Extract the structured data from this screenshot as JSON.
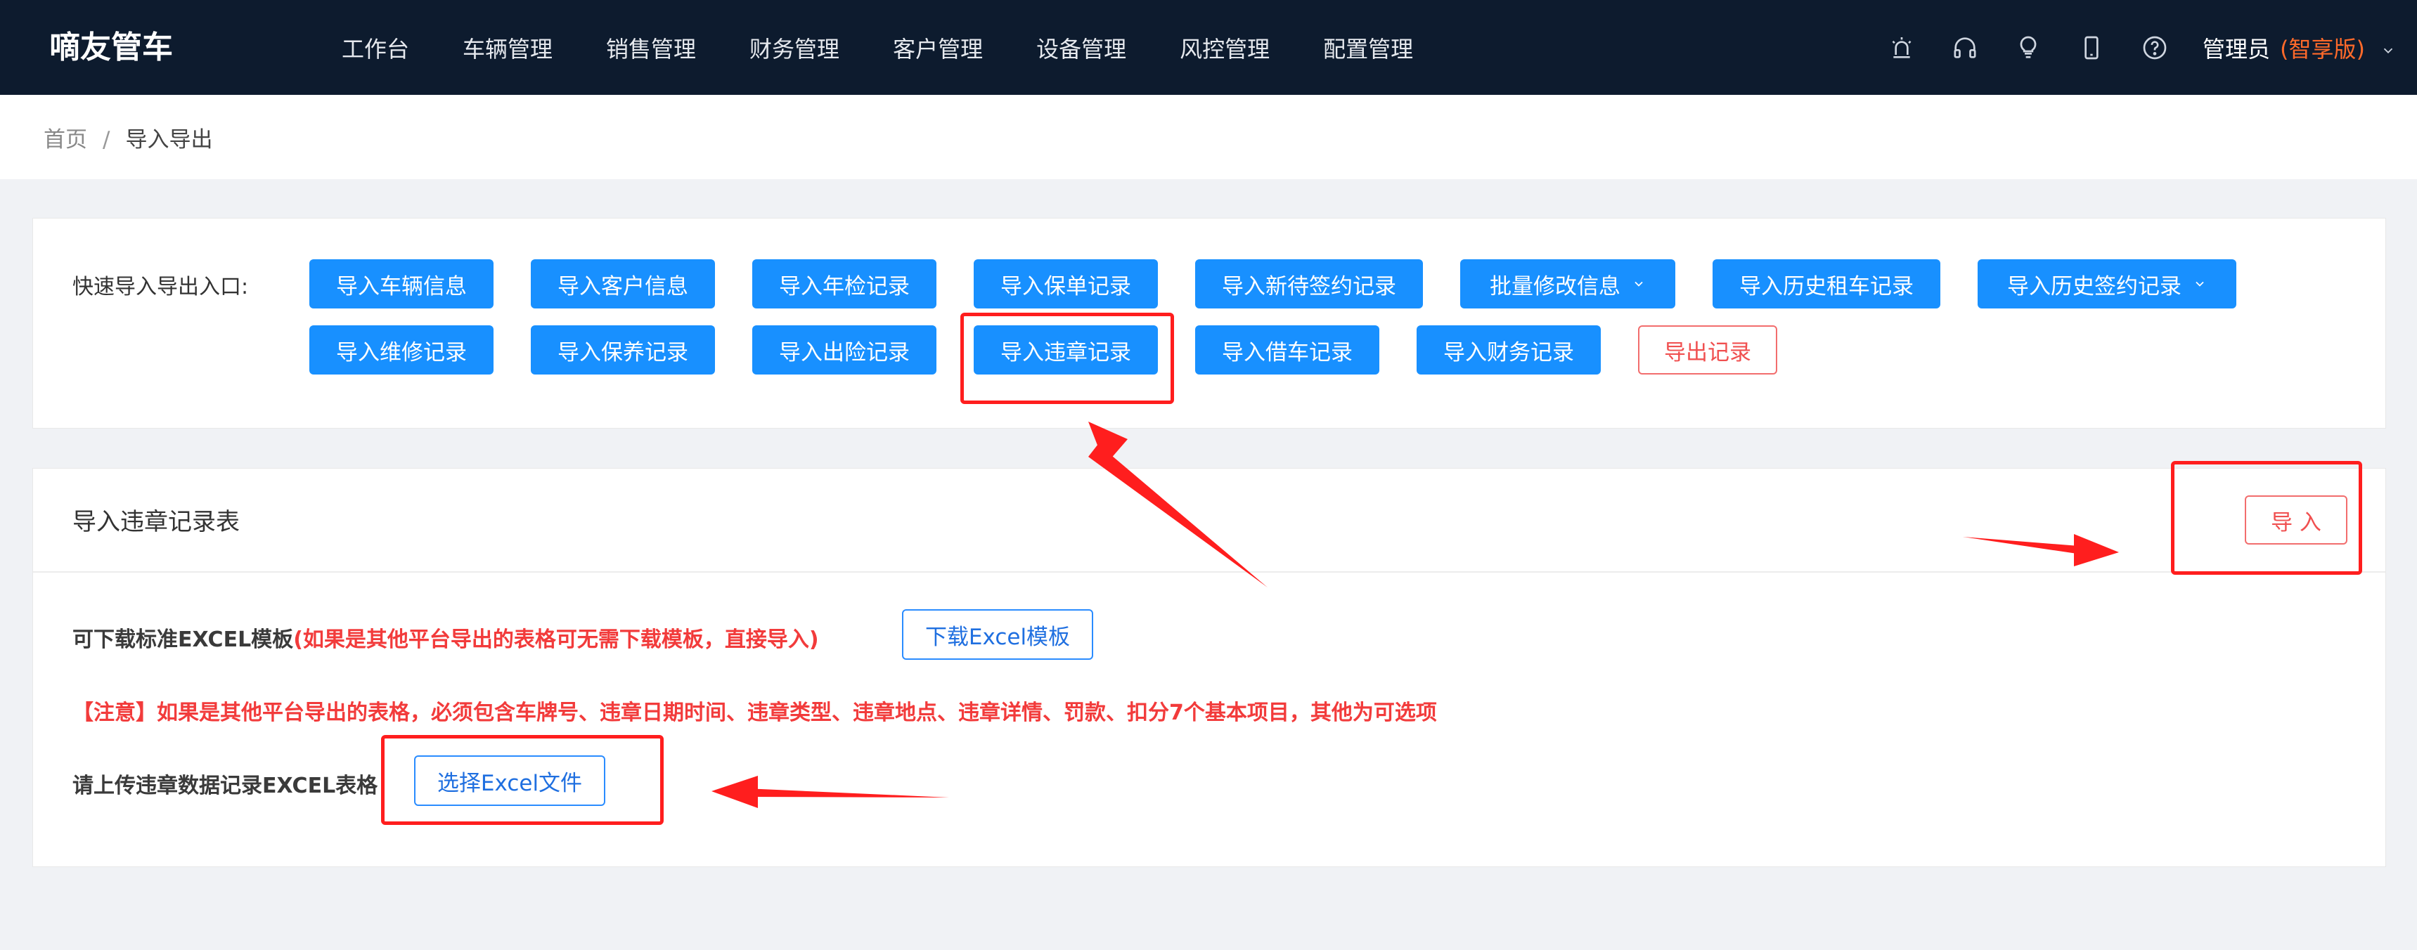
{
  "app": {
    "title": "嘀友管车"
  },
  "nav": {
    "items": [
      "工作台",
      "车辆管理",
      "销售管理",
      "财务管理",
      "客户管理",
      "设备管理",
      "风控管理",
      "配置管理"
    ]
  },
  "header": {
    "icons": [
      "alarm-icon",
      "headset-icon",
      "bulb-icon",
      "mobile-icon",
      "help-icon"
    ],
    "user_name": "管理员",
    "edition": "(智享版)"
  },
  "breadcrumb": {
    "home": "首页",
    "separator": "/",
    "current": "导入导出"
  },
  "quick": {
    "label": "快速导入导出入口:",
    "row1": [
      {
        "label": "导入车辆信息"
      },
      {
        "label": "导入客户信息"
      },
      {
        "label": "导入年检记录"
      },
      {
        "label": "导入保单记录"
      },
      {
        "label": "导入新待签约记录"
      },
      {
        "label": "批量修改信息",
        "dropdown": true
      },
      {
        "label": "导入历史租车记录"
      },
      {
        "label": "导入历史签约记录",
        "dropdown": true
      }
    ],
    "row2": [
      {
        "label": "导入维修记录"
      },
      {
        "label": "导入保养记录"
      },
      {
        "label": "导入出险记录"
      },
      {
        "label": "导入违章记录"
      },
      {
        "label": "导入借车记录"
      },
      {
        "label": "导入财务记录"
      },
      {
        "label": "导出记录"
      }
    ]
  },
  "import_panel": {
    "title": "导入违章记录表",
    "import_button": "导 入",
    "template_label": "可下载标准EXCEL模板",
    "template_note": "(如果是其他平台导出的表格可无需下载模板，直接导入)",
    "download_button": "下载Excel模板",
    "notice": "【注意】如果是其他平台导出的表格，必须包含车牌号、违章日期时间、违章类型、违章地点、违章详情、罚款、扣分7个基本项目，其他为可选项",
    "upload_label": "请上传违章数据记录EXCEL表格",
    "choose_file_button": "选择Excel文件"
  },
  "colors": {
    "topbar": "#0d1b2e",
    "primary": "#1890ff",
    "danger": "#f05050",
    "edition": "#ff6a2a",
    "annotation": "#ff1e1e"
  }
}
